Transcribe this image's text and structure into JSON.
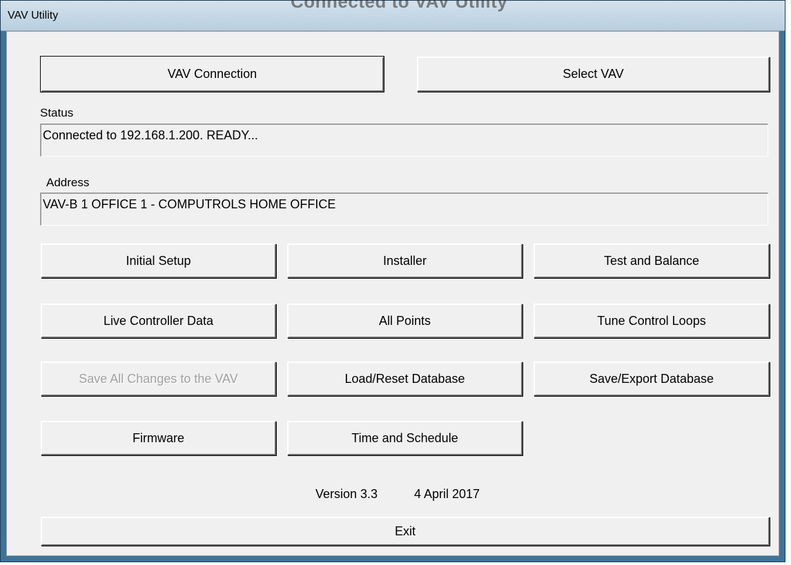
{
  "window": {
    "title": "VAV Utility",
    "ghost_title": "Connected to VAV Utility"
  },
  "top_buttons": {
    "connection": "VAV Connection",
    "select": "Select VAV"
  },
  "status": {
    "label": "Status",
    "value": "Connected to 192.168.1.200.  READY..."
  },
  "address": {
    "label": "Address",
    "value": "VAV-B 1 OFFICE 1 - COMPUTROLS HOME OFFICE"
  },
  "grid_buttons": {
    "initial_setup": "Initial Setup",
    "installer": "Installer",
    "test_balance": "Test and Balance",
    "live_data": "Live Controller Data",
    "all_points": "All Points",
    "tune_loops": "Tune Control Loops",
    "save_changes": "Save All Changes to the VAV",
    "load_reset": "Load/Reset Database",
    "save_export": "Save/Export Database",
    "firmware": "Firmware",
    "time_schedule": "Time and Schedule"
  },
  "footer": {
    "version": "Version 3.3",
    "date": "4 April 2017",
    "exit": "Exit"
  }
}
